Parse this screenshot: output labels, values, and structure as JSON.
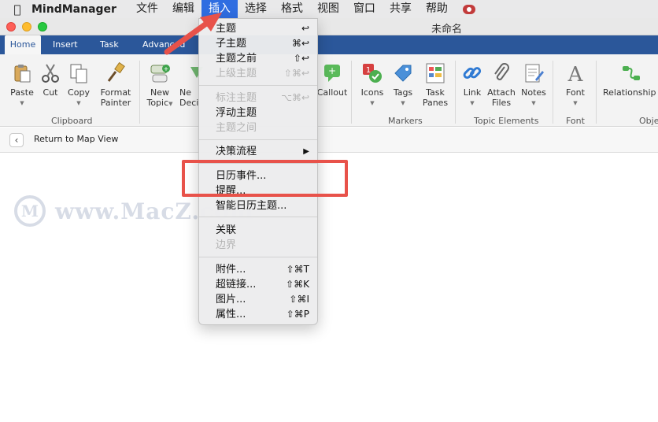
{
  "menubar": {
    "app_name": "MindManager",
    "menus": [
      "文件",
      "编辑",
      "插入",
      "选择",
      "格式",
      "视图",
      "窗口",
      "共享",
      "帮助"
    ],
    "active_menu": "插入"
  },
  "window": {
    "title": "未命名"
  },
  "ribbon_tabs": [
    "Home",
    "Insert",
    "Task",
    "Advanced"
  ],
  "ribbon": {
    "buttons": {
      "paste": "Paste",
      "cut": "Cut",
      "copy": "Copy",
      "format_painter_1": "Format",
      "format_painter_2": "Painter",
      "new_topic_1": "New",
      "new_topic_2": "Topic",
      "new_decision_1": "Ne",
      "new_decision_2": "Deci",
      "callout": "Callout",
      "icons": "Icons",
      "tags": "Tags",
      "task_panes_1": "Task",
      "task_panes_2": "Panes",
      "link": "Link",
      "attach_files_1": "Attach",
      "attach_files_2": "Files",
      "notes": "Notes",
      "font": "Font",
      "relationship": "Relationship"
    },
    "groups": {
      "clipboard": "Clipboard",
      "markers": "Markers",
      "topic_elements": "Topic Elements",
      "font": "Font",
      "objects": "Obje"
    }
  },
  "return_bar": {
    "label": "Return to Map View"
  },
  "watermark": {
    "text": "www.MacZ.com",
    "logo": "M"
  },
  "dropdown": {
    "items": [
      {
        "label": "主题",
        "shortcut": "↩",
        "disabled": false
      },
      {
        "label": "子主题",
        "shortcut": "⌘↩",
        "disabled": false
      },
      {
        "label": "主题之前",
        "shortcut": "⇧↩",
        "disabled": false
      },
      {
        "label": "上级主题",
        "shortcut": "⇧⌘↩",
        "disabled": true
      },
      {
        "label": "标注主题",
        "shortcut": "⌥⌘↩",
        "disabled": true
      },
      {
        "label": "浮动主题",
        "shortcut": "",
        "disabled": false
      },
      {
        "label": "主题之间",
        "shortcut": "",
        "disabled": true
      },
      {
        "label": "决策流程",
        "shortcut": "▶",
        "disabled": false
      },
      {
        "label": "日历事件...",
        "shortcut": "",
        "disabled": false
      },
      {
        "label": "提醒...",
        "shortcut": "",
        "disabled": false
      },
      {
        "label": "智能日历主题...",
        "shortcut": "",
        "disabled": false
      },
      {
        "label": "关联",
        "shortcut": "",
        "disabled": false
      },
      {
        "label": "边界",
        "shortcut": "",
        "disabled": true
      },
      {
        "label": "附件...",
        "shortcut": "⇧⌘T",
        "disabled": false
      },
      {
        "label": "超链接...",
        "shortcut": "⇧⌘K",
        "disabled": false
      },
      {
        "label": "图片...",
        "shortcut": "⇧⌘I",
        "disabled": false
      },
      {
        "label": "属性...",
        "shortcut": "⇧⌘P",
        "disabled": false
      }
    ]
  },
  "colors": {
    "ribbon_blue": "#2b579a",
    "menu_highlight": "#2f6de1",
    "annotation_red": "#e8524a"
  },
  "icons": [
    "apple-icon",
    "paste-icon",
    "scissors-icon",
    "copy-icon",
    "brush-icon",
    "new-topic-icon",
    "callout-icon",
    "icons-marker-icon",
    "tag-icon",
    "task-panes-icon",
    "link-icon",
    "paperclip-icon",
    "notes-icon",
    "font-icon",
    "relationship-icon",
    "chevron-left-icon"
  ]
}
